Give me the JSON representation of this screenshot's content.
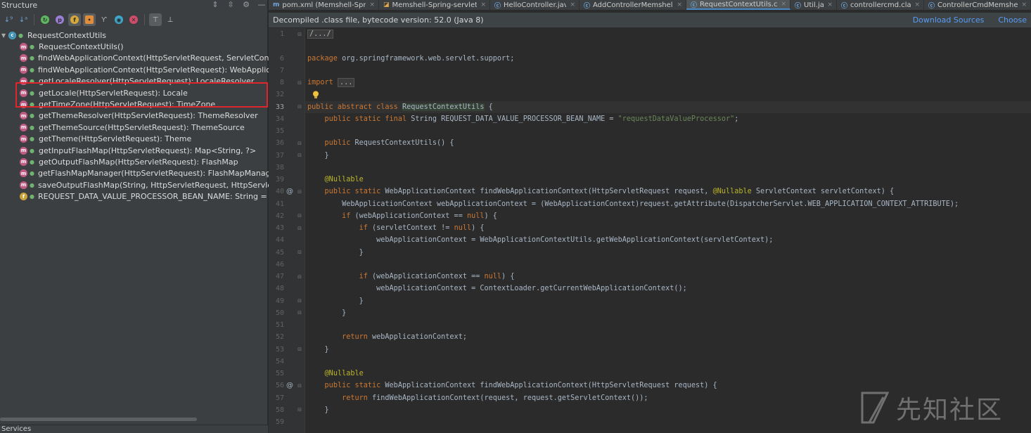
{
  "structure": {
    "title": "Structure",
    "root": "RequestContextUtils",
    "items": [
      {
        "label": "RequestContextUtils()",
        "kind": "method"
      },
      {
        "label": "findWebApplicationContext(HttpServletRequest, ServletContext):",
        "kind": "method"
      },
      {
        "label": "findWebApplicationContext(HttpServletRequest): WebApplication",
        "kind": "method"
      },
      {
        "label": "getLocaleResolver(HttpServletRequest): LocaleResolver",
        "kind": "method"
      },
      {
        "label": "getLocale(HttpServletRequest): Locale",
        "kind": "method"
      },
      {
        "label": "getTimeZone(HttpServletRequest): TimeZone",
        "kind": "method"
      },
      {
        "label": "getThemeResolver(HttpServletRequest): ThemeResolver",
        "kind": "method"
      },
      {
        "label": "getThemeSource(HttpServletRequest): ThemeSource",
        "kind": "method"
      },
      {
        "label": "getTheme(HttpServletRequest): Theme",
        "kind": "method"
      },
      {
        "label": "getInputFlashMap(HttpServletRequest): Map<String, ?>",
        "kind": "method"
      },
      {
        "label": "getOutputFlashMap(HttpServletRequest): FlashMap",
        "kind": "method"
      },
      {
        "label": "getFlashMapManager(HttpServletRequest): FlashMapManager",
        "kind": "method"
      },
      {
        "label": "saveOutputFlashMap(String, HttpServletRequest, HttpServletRes",
        "kind": "method"
      },
      {
        "label": "REQUEST_DATA_VALUE_PROCESSOR_BEAN_NAME: String = \"re",
        "kind": "field"
      }
    ]
  },
  "services_label": "Services",
  "tabs": [
    {
      "label": "pom.xml (Memshell-Spring",
      "icon": "m",
      "active": false
    },
    {
      "label": "Memshell-Spring-servlet.xm",
      "icon": "xml",
      "active": false
    },
    {
      "label": "HelloController.java",
      "icon": "c",
      "active": false
    },
    {
      "label": "AddControllerMemshell.java",
      "icon": "c",
      "active": false
    },
    {
      "label": "RequestContextUtils.class",
      "icon": "c",
      "active": true
    },
    {
      "label": "Util.java",
      "icon": "c",
      "active": false
    },
    {
      "label": "controllercmd.class",
      "icon": "c",
      "active": false
    },
    {
      "label": "ControllerCmdMemshell.ja",
      "icon": "c",
      "active": false
    }
  ],
  "infobar": {
    "text": "Decompiled .class file, bytecode version: 52.0 (Java 8)",
    "download_sources": "Download Sources",
    "choose": "Choose"
  },
  "code_lines": [
    {
      "n": "1",
      "html": "<span class=\"fold-box\">/.../</span>"
    },
    {
      "n": "",
      "html": ""
    },
    {
      "n": "6",
      "html": "<span class=\"kw\">package</span> org.springframework.web.servlet.support;"
    },
    {
      "n": "7",
      "html": ""
    },
    {
      "n": "8",
      "html": "<span class=\"kw\">import</span> <span class=\"fold-box\">...</span>"
    },
    {
      "n": "32",
      "html": ""
    },
    {
      "n": "33",
      "html": "<span class=\"kw\">public abstract class</span> <span class=\"cls-hl\">RequestContextUtils</span> {"
    },
    {
      "n": "34",
      "html": "    <span class=\"kw\">public static final</span> String REQUEST_DATA_VALUE_PROCESSOR_BEAN_NAME = <span class=\"str\">\"requestDataValueProcessor\"</span>;"
    },
    {
      "n": "35",
      "html": ""
    },
    {
      "n": "36",
      "html": "    <span class=\"kw\">public</span> RequestContextUtils() {"
    },
    {
      "n": "37",
      "html": "    }"
    },
    {
      "n": "38",
      "html": ""
    },
    {
      "n": "39",
      "html": "    <span class=\"ann\">@Nullable</span>"
    },
    {
      "n": "40",
      "html": "    <span class=\"kw\">public static</span> WebApplicationContext findWebApplicationContext(HttpServletRequest request, <span class=\"ann\">@Nullable</span> ServletContext servletContext) {"
    },
    {
      "n": "41",
      "html": "        WebApplicationContext webApplicationContext = (WebApplicationContext)request.getAttribute(DispatcherServlet.WEB_APPLICATION_CONTEXT_ATTRIBUTE);"
    },
    {
      "n": "42",
      "html": "        <span class=\"kw\">if</span> (webApplicationContext == <span class=\"kw\">null</span>) {"
    },
    {
      "n": "43",
      "html": "            <span class=\"kw\">if</span> (servletContext != <span class=\"kw\">null</span>) {"
    },
    {
      "n": "44",
      "html": "                webApplicationContext = WebApplicationContextUtils.getWebApplicationContext(servletContext);"
    },
    {
      "n": "45",
      "html": "            }"
    },
    {
      "n": "46",
      "html": ""
    },
    {
      "n": "47",
      "html": "            <span class=\"kw\">if</span> (webApplicationContext == <span class=\"kw\">null</span>) {"
    },
    {
      "n": "48",
      "html": "                webApplicationContext = ContextLoader.getCurrentWebApplicationContext();"
    },
    {
      "n": "49",
      "html": "            }"
    },
    {
      "n": "50",
      "html": "        }"
    },
    {
      "n": "51",
      "html": ""
    },
    {
      "n": "52",
      "html": "        <span class=\"kw\">return</span> webApplicationContext;"
    },
    {
      "n": "53",
      "html": "    }"
    },
    {
      "n": "54",
      "html": ""
    },
    {
      "n": "55",
      "html": "    <span class=\"ann\">@Nullable</span>"
    },
    {
      "n": "56",
      "html": "    <span class=\"kw\">public static</span> WebApplicationContext findWebApplicationContext(HttpServletRequest request) {"
    },
    {
      "n": "57",
      "html": "        <span class=\"kw\">return</span> findWebApplicationContext(request, request.getServletContext());"
    },
    {
      "n": "58",
      "html": "    }"
    },
    {
      "n": "59",
      "html": ""
    }
  ],
  "gutter_marks": {
    "40": "@",
    "56": "@"
  },
  "watermark": "先知社区",
  "colors": {
    "accent": "#4a88c7",
    "highlight_box": "#e0262a",
    "link": "#589df6"
  }
}
